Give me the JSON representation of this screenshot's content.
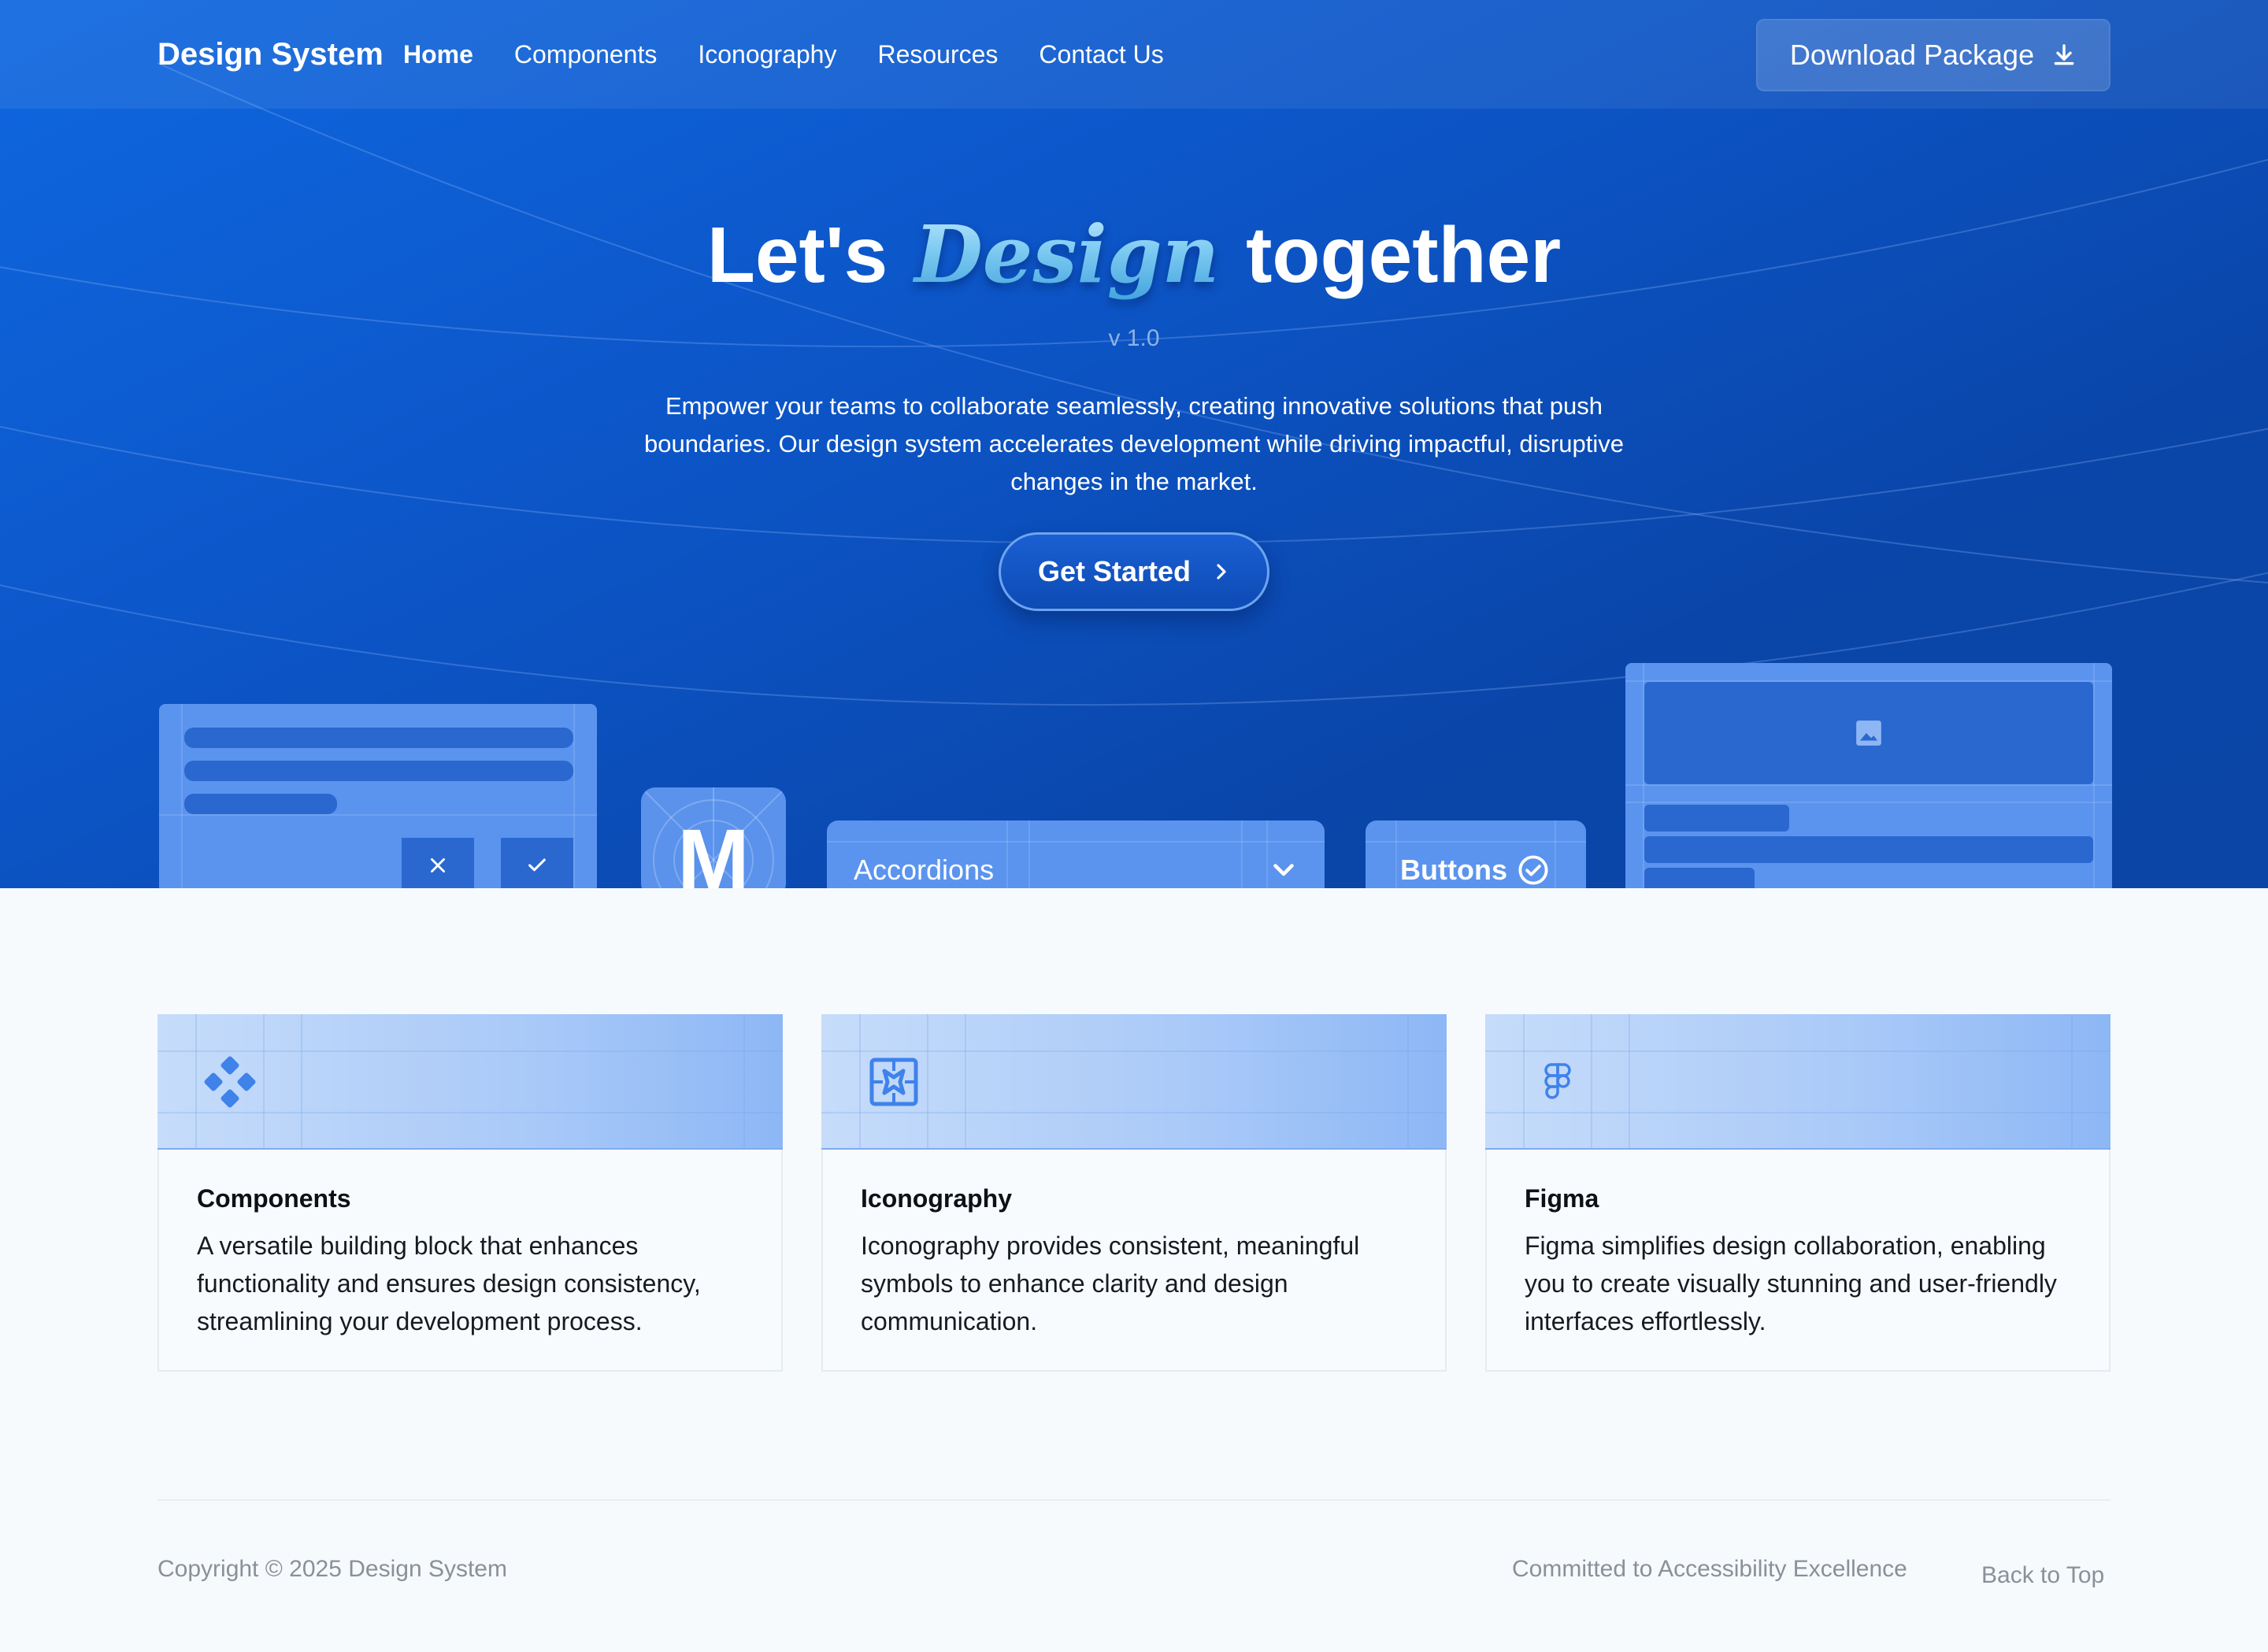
{
  "brand": "Design System",
  "nav": [
    {
      "label": "Home",
      "active": true
    },
    {
      "label": "Components"
    },
    {
      "label": "Iconography"
    },
    {
      "label": "Resources"
    },
    {
      "label": "Contact Us"
    }
  ],
  "download": {
    "label": "Download Package",
    "icon": "download-icon"
  },
  "hero": {
    "headline_pre": "Let's",
    "headline_em": "Design",
    "headline_post": "together",
    "version": "v 1.0",
    "lead": "Empower your teams to collaborate seamlessly, creating innovative solutions that push boundaries. Our design system accelerates development while driving impactful, disruptive changes in the market.",
    "cta": "Get Started"
  },
  "mock": {
    "material_letter": "M",
    "accordion_label": "Accordions",
    "buttons_label": "Buttons"
  },
  "cards": [
    {
      "icon": "components-icon",
      "title": "Components",
      "text": "A versatile building block that enhances functionality and ensures design consistency, streamlining your development process."
    },
    {
      "icon": "iconography-icon",
      "title": "Iconography",
      "text": "Iconography provides consistent, meaningful symbols to enhance clarity and design communication."
    },
    {
      "icon": "figma-icon",
      "title": "Figma",
      "text": "Figma simplifies design collaboration, enabling you to create visually stunning and user-friendly interfaces effortlessly."
    }
  ],
  "footer": {
    "copyright": "Copyright © 2025 Design System",
    "accessibility": "Committed to Accessibility Excellence",
    "back_to_top": "Back to Top"
  },
  "colors": {
    "hero": "#0c55c7",
    "accent": "#5b94ee",
    "card_header": "#a9c9f8"
  }
}
